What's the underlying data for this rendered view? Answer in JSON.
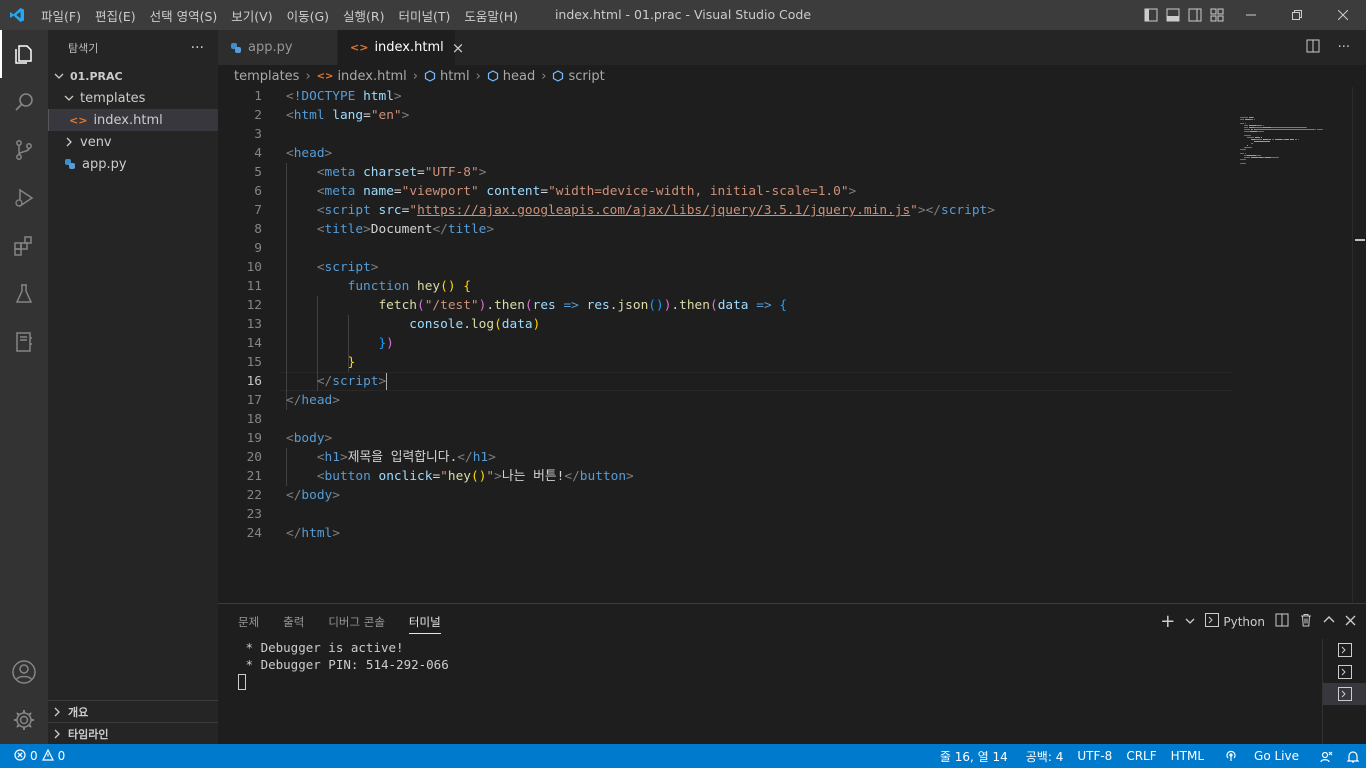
{
  "window": {
    "title": "index.html - 01.prac - Visual Studio Code"
  },
  "menu": [
    "파일(F)",
    "편집(E)",
    "선택 영역(S)",
    "보기(V)",
    "이동(G)",
    "실행(R)",
    "터미널(T)",
    "도움말(H)"
  ],
  "sidebar": {
    "title": "탐색기",
    "more": "···",
    "folder": "01.PRAC",
    "items": [
      {
        "label": "templates"
      },
      {
        "label": "index.html"
      },
      {
        "label": "venv"
      },
      {
        "label": "app.py"
      }
    ],
    "outline": "개요",
    "timeline": "타임라인"
  },
  "tabs": [
    {
      "label": "app.py"
    },
    {
      "label": "index.html",
      "close": "×"
    }
  ],
  "breadcrumb": [
    "templates",
    "index.html",
    "html",
    "head",
    "script"
  ],
  "editor": {
    "current_line": 16,
    "line_numbers": [
      "1",
      "2",
      "3",
      "4",
      "5",
      "6",
      "7",
      "8",
      "9",
      "10",
      "11",
      "12",
      "13",
      "14",
      "15",
      "16",
      "17",
      "18",
      "19",
      "20",
      "21",
      "22",
      "23",
      "24"
    ],
    "lines": [
      [
        [
          "p",
          "<"
        ],
        [
          "t",
          "!DOCTYPE"
        ],
        [
          "d",
          " "
        ],
        [
          "a",
          "html"
        ],
        [
          "p",
          ">"
        ]
      ],
      [
        [
          "p",
          "<"
        ],
        [
          "t",
          "html"
        ],
        [
          "d",
          " "
        ],
        [
          "a",
          "lang"
        ],
        [
          "d",
          "="
        ],
        [
          "s",
          "\"en\""
        ],
        [
          "p",
          ">"
        ]
      ],
      [],
      [
        [
          "p",
          "<"
        ],
        [
          "t",
          "head"
        ],
        [
          "p",
          ">"
        ]
      ],
      [
        [
          "d",
          "    "
        ],
        [
          "p",
          "<"
        ],
        [
          "t",
          "meta"
        ],
        [
          "d",
          " "
        ],
        [
          "a",
          "charset"
        ],
        [
          "d",
          "="
        ],
        [
          "s",
          "\"UTF-8\""
        ],
        [
          "p",
          ">"
        ]
      ],
      [
        [
          "d",
          "    "
        ],
        [
          "p",
          "<"
        ],
        [
          "t",
          "meta"
        ],
        [
          "d",
          " "
        ],
        [
          "a",
          "name"
        ],
        [
          "d",
          "="
        ],
        [
          "s",
          "\"viewport\""
        ],
        [
          "d",
          " "
        ],
        [
          "a",
          "content"
        ],
        [
          "d",
          "="
        ],
        [
          "s",
          "\"width=device-width, initial-scale=1.0\""
        ],
        [
          "p",
          ">"
        ]
      ],
      [
        [
          "d",
          "    "
        ],
        [
          "p",
          "<"
        ],
        [
          "t",
          "script"
        ],
        [
          "d",
          " "
        ],
        [
          "a",
          "src"
        ],
        [
          "d",
          "="
        ],
        [
          "s",
          "\""
        ],
        [
          "su",
          "https://ajax.googleapis.com/ajax/libs/jquery/3.5.1/jquery.min.js"
        ],
        [
          "s",
          "\""
        ],
        [
          "p",
          "></"
        ],
        [
          "t",
          "script"
        ],
        [
          "p",
          ">"
        ]
      ],
      [
        [
          "d",
          "    "
        ],
        [
          "p",
          "<"
        ],
        [
          "t",
          "title"
        ],
        [
          "p",
          ">"
        ],
        [
          "d",
          "Document"
        ],
        [
          "p",
          "</"
        ],
        [
          "t",
          "title"
        ],
        [
          "p",
          ">"
        ]
      ],
      [],
      [
        [
          "d",
          "    "
        ],
        [
          "p",
          "<"
        ],
        [
          "t",
          "script"
        ],
        [
          "p",
          ">"
        ]
      ],
      [
        [
          "d",
          "        "
        ],
        [
          "t",
          "function"
        ],
        [
          "d",
          " "
        ],
        [
          "f",
          "hey"
        ],
        [
          "y",
          "()"
        ],
        [
          "d",
          " "
        ],
        [
          "y",
          "{"
        ]
      ],
      [
        [
          "d",
          "            "
        ],
        [
          "f",
          "fetch"
        ],
        [
          "m",
          "("
        ],
        [
          "s",
          "\"/test\""
        ],
        [
          "m",
          ")"
        ],
        [
          "d",
          "."
        ],
        [
          "f",
          "then"
        ],
        [
          "m",
          "("
        ],
        [
          "v",
          "res"
        ],
        [
          "d",
          " "
        ],
        [
          "t",
          "=>"
        ],
        [
          "d",
          " "
        ],
        [
          "v",
          "res"
        ],
        [
          "d",
          "."
        ],
        [
          "f",
          "json"
        ],
        [
          "b",
          "()"
        ],
        [
          "m",
          ")"
        ],
        [
          "d",
          "."
        ],
        [
          "f",
          "then"
        ],
        [
          "m",
          "("
        ],
        [
          "v",
          "data"
        ],
        [
          "d",
          " "
        ],
        [
          "t",
          "=>"
        ],
        [
          "d",
          " "
        ],
        [
          "b",
          "{"
        ]
      ],
      [
        [
          "d",
          "                "
        ],
        [
          "v",
          "console"
        ],
        [
          "d",
          "."
        ],
        [
          "f",
          "log"
        ],
        [
          "y",
          "("
        ],
        [
          "v",
          "data"
        ],
        [
          "y",
          ")"
        ]
      ],
      [
        [
          "d",
          "            "
        ],
        [
          "b",
          "}"
        ],
        [
          "m",
          ")"
        ]
      ],
      [
        [
          "d",
          "        "
        ],
        [
          "y",
          "}"
        ]
      ],
      [
        [
          "d",
          "    "
        ],
        [
          "p",
          "</"
        ],
        [
          "t",
          "script"
        ],
        [
          "p",
          ">"
        ]
      ],
      [
        [
          "p",
          "</"
        ],
        [
          "t",
          "head"
        ],
        [
          "p",
          ">"
        ]
      ],
      [],
      [
        [
          "p",
          "<"
        ],
        [
          "t",
          "body"
        ],
        [
          "p",
          ">"
        ]
      ],
      [
        [
          "d",
          "    "
        ],
        [
          "p",
          "<"
        ],
        [
          "t",
          "h1"
        ],
        [
          "p",
          ">"
        ],
        [
          "d",
          "제목을 입력합니다."
        ],
        [
          "p",
          "</"
        ],
        [
          "t",
          "h1"
        ],
        [
          "p",
          ">"
        ]
      ],
      [
        [
          "d",
          "    "
        ],
        [
          "p",
          "<"
        ],
        [
          "t",
          "button"
        ],
        [
          "d",
          " "
        ],
        [
          "a",
          "onclick"
        ],
        [
          "d",
          "="
        ],
        [
          "s",
          "\""
        ],
        [
          "f",
          "hey"
        ],
        [
          "y",
          "()"
        ],
        [
          "s",
          "\""
        ],
        [
          "p",
          ">"
        ],
        [
          "d",
          "나는 버튼!"
        ],
        [
          "p",
          "</"
        ],
        [
          "t",
          "button"
        ],
        [
          "p",
          ">"
        ]
      ],
      [
        [
          "p",
          "</"
        ],
        [
          "t",
          "body"
        ],
        [
          "p",
          ">"
        ]
      ],
      [],
      [
        [
          "p",
          "</"
        ],
        [
          "t",
          "html"
        ],
        [
          "p",
          ">"
        ]
      ]
    ]
  },
  "panel": {
    "tabs": [
      "문제",
      "출력",
      "디버그 콘솔",
      "터미널"
    ],
    "active_tab": "터미널",
    "terminal_name": "Python",
    "terminal_lines": [
      " * Debugger is active!",
      " * Debugger PIN: 514-292-066"
    ]
  },
  "status": {
    "errors": "0",
    "warnings": "0",
    "position": "줄 16, 열 14",
    "spaces": "공백: 4",
    "encoding": "UTF-8",
    "eol": "CRLF",
    "language": "HTML",
    "golive": "Go Live"
  },
  "colors": {
    "accent": "#007acc",
    "titlebar": "#3c3c3c",
    "activitybar": "#333333",
    "sidebar": "#252526",
    "editor": "#1e1e1e"
  }
}
